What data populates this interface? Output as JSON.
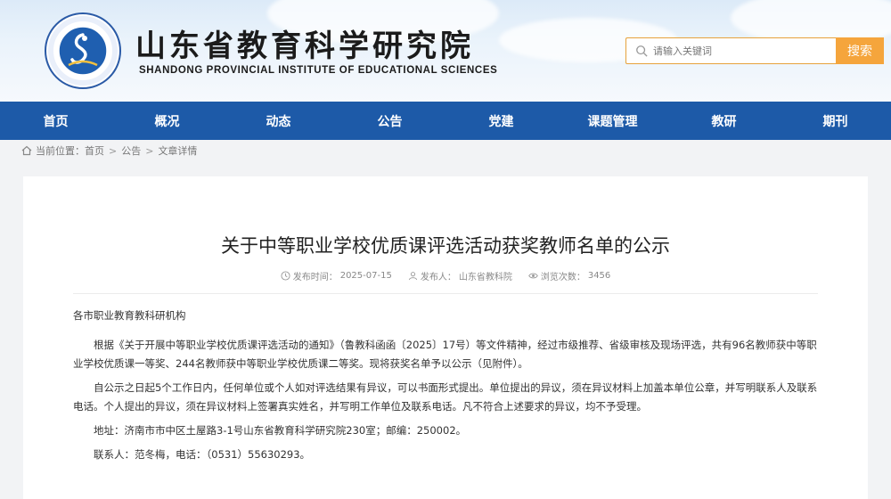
{
  "header": {
    "logo_text": "山东省教育科学研究院",
    "title_cn": "山东省教育科学研究院",
    "title_en": "SHANDONG PROVINCIAL INSTITUTE OF EDUCATIONAL SCIENCES"
  },
  "search": {
    "placeholder": "请输入关键词",
    "button_label": "搜索"
  },
  "nav": {
    "items": [
      {
        "label": "首页"
      },
      {
        "label": "概况"
      },
      {
        "label": "动态"
      },
      {
        "label": "公告"
      },
      {
        "label": "党建"
      },
      {
        "label": "课题管理"
      },
      {
        "label": "教研"
      },
      {
        "label": "期刊"
      }
    ]
  },
  "breadcrumb": {
    "prefix": "当前位置：",
    "home": "首页",
    "section": "公告",
    "current": "文章详情",
    "separator": ">"
  },
  "article": {
    "title": "关于中等职业学校优质课评选活动获奖教师名单的公示",
    "publish_date_label": "发布时间：",
    "publish_date": "2025-07-15",
    "publisher_label": "发布人：",
    "publisher": "山东省教科院",
    "views_label": "浏览次数：",
    "views": "3456",
    "salutation": "各市职业教育教科研机构",
    "paragraphs": [
      "根据《关于开展中等职业学校优质课评选活动的通知》（鲁教科函函〔2025〕17号）等文件精神，经过市级推荐、省级审核及现场评选，共有96名教师获中等职业学校优质课一等奖、244名教师获中等职业学校优质课二等奖。现将获奖名单予以公示（见附件）。",
      "自公示之日起5个工作日内，任何单位或个人如对评选结果有异议，可以书面形式提出。单位提出的异议，须在异议材料上加盖本单位公章，并写明联系人及联系电话。个人提出的异议，须在异议材料上签署真实姓名，并写明工作单位及联系电话。凡不符合上述要求的异议，均不予受理。",
      "地址：济南市市中区土屋路3-1号山东省教育科学研究院230室；邮编：250002。",
      "联系人：范冬梅，电话：（0531）55630293。"
    ]
  },
  "colors": {
    "nav_bg": "#1d5aa8",
    "search_button": "#f5a53c",
    "accent_border": "#e6a23c"
  }
}
